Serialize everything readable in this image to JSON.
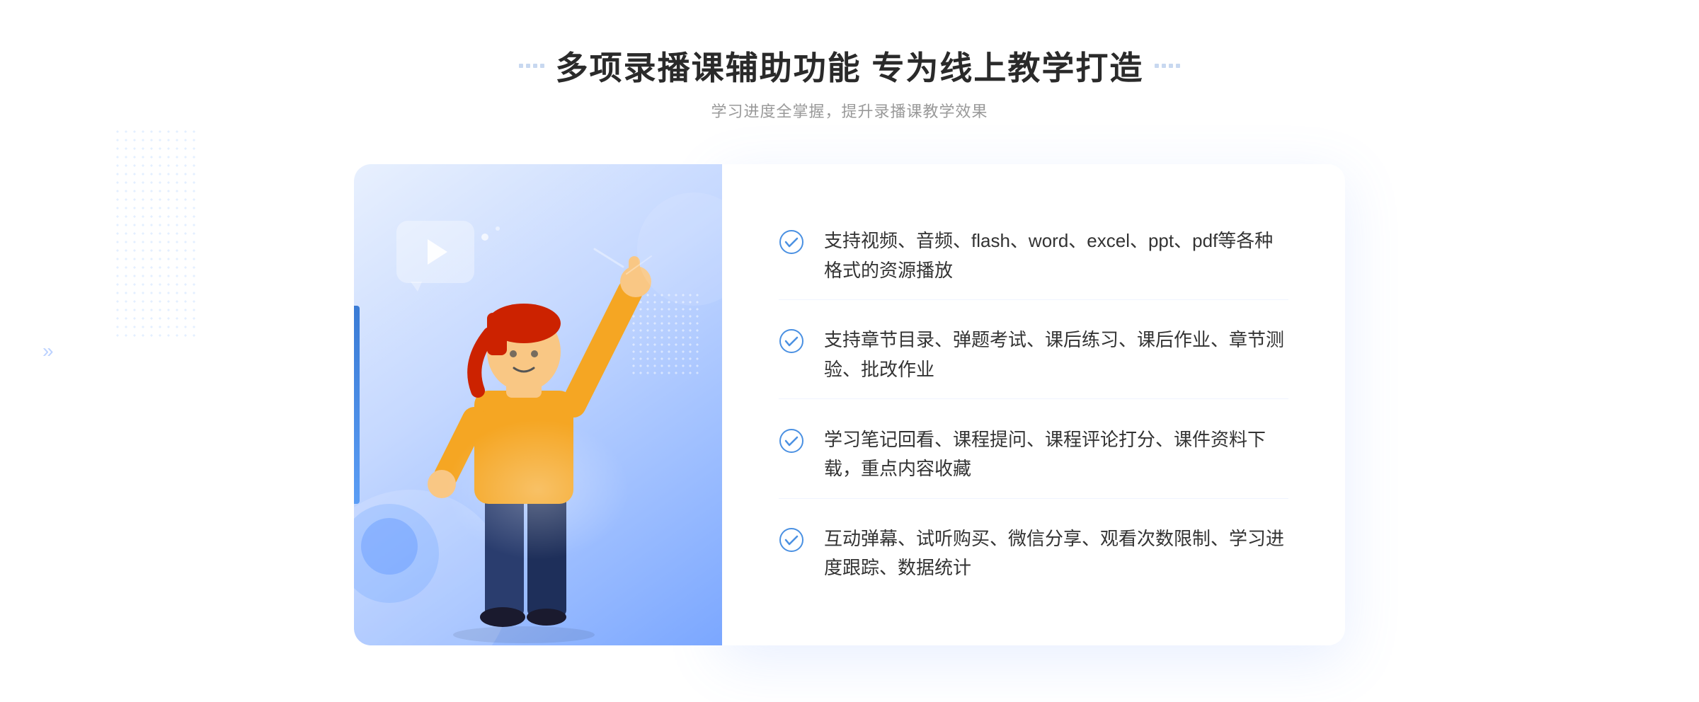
{
  "header": {
    "title": "多项录播课辅助功能 专为线上教学打造",
    "subtitle": "学习进度全掌握，提升录播课教学效果",
    "title_dots": "decorative"
  },
  "features": [
    {
      "id": 1,
      "text": "支持视频、音频、flash、word、excel、ppt、pdf等各种格式的资源播放"
    },
    {
      "id": 2,
      "text": "支持章节目录、弹题考试、课后练习、课后作业、章节测验、批改作业"
    },
    {
      "id": 3,
      "text": "学习笔记回看、课程提问、课程评论打分、课件资料下载，重点内容收藏"
    },
    {
      "id": 4,
      "text": "互动弹幕、试听购买、微信分享、观看次数限制、学习进度跟踪、数据统计"
    }
  ],
  "decoration": {
    "chevrons": "»",
    "play_icon": "▶"
  },
  "colors": {
    "primary": "#3a7bd5",
    "accent": "#5b9df5",
    "light_blue": "#e8f0fe",
    "check_color": "#4a90e2",
    "text_dark": "#2a2a2a",
    "text_gray": "#999"
  }
}
